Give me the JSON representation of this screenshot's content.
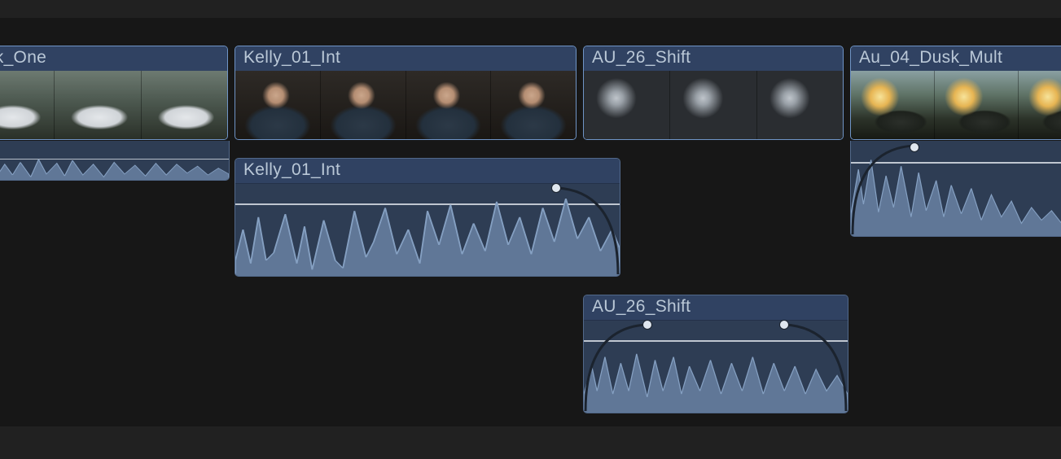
{
  "clips": {
    "video1_label": "usk_One",
    "video2_label": "Kelly_01_Int",
    "video3_label": "AU_26_Shift",
    "video4_label": "Au_04_Dusk_Mult",
    "audio1_label": "Kelly_01_Int",
    "audio2_label": "AU_26_Shift"
  },
  "colors": {
    "clip_border": "#6f94c6",
    "clip_header": "#304262",
    "clip_body": "#2b3b51",
    "waveform": "#607797",
    "background": "#171717"
  }
}
